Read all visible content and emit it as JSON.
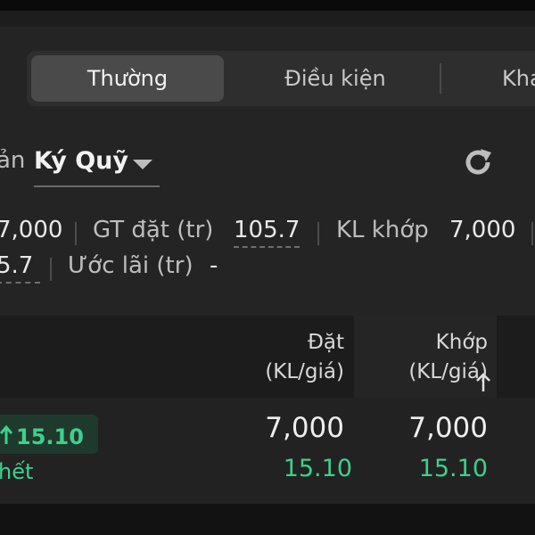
{
  "tabs": [
    {
      "label": "Thường",
      "active": true
    },
    {
      "label": "Điều kiện",
      "active": false
    },
    {
      "label": "Kha",
      "active": false
    }
  ],
  "account": {
    "prefix": "ản",
    "selected": "Ký Quỹ"
  },
  "stats": {
    "line1": {
      "first_value": "7,000",
      "gt_dat_label": "GT đặt (tr)",
      "gt_dat_value": "105.7",
      "kl_khop_label": "KL khớp",
      "kl_khop_value": "7,000"
    },
    "line2": {
      "first_value": "5.7",
      "uoc_lai_label": "Ước lãi (tr)",
      "uoc_lai_value": "-"
    }
  },
  "table": {
    "headers": {
      "dat_line1": "Đặt",
      "dat_line2": "(KL/giá)",
      "khop_line1": "Khớp",
      "khop_line2": "(KL/giá)"
    },
    "rows": [
      {
        "price": "15.10",
        "status": "hết",
        "dat_qty": "7,000",
        "dat_price": "15.10",
        "khop_qty": "7,000",
        "khop_price": "15.10"
      }
    ]
  },
  "colors": {
    "accent_green": "#3fcf8e",
    "panel_bg": "#242424"
  },
  "icons": [
    "chevron-down-icon",
    "refresh-icon",
    "arrow-up-icon",
    "sort-arrow-icon"
  ]
}
